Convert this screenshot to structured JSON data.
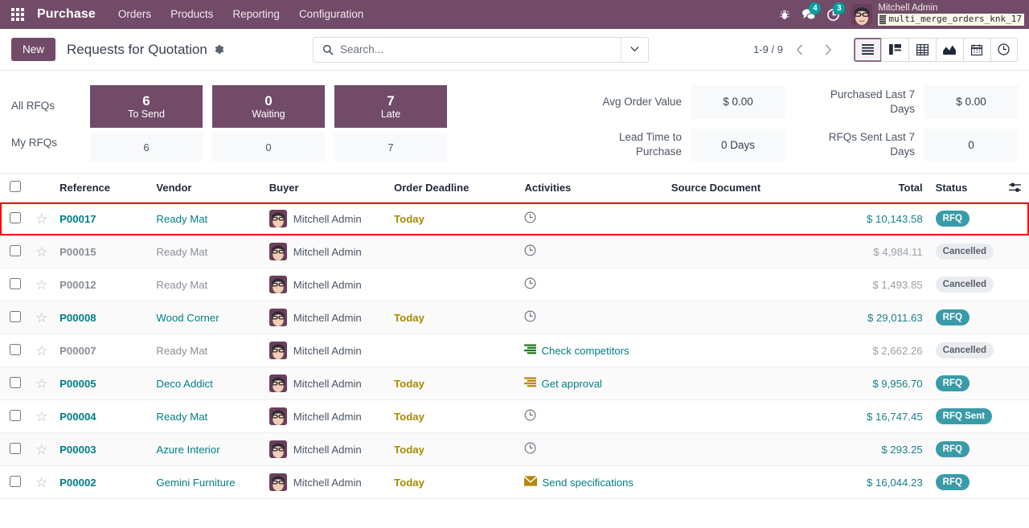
{
  "navbar": {
    "apps_icon": "grid-apps-icon",
    "brand": "Purchase",
    "menus": [
      "Orders",
      "Products",
      "Reporting",
      "Configuration"
    ],
    "icons": [
      {
        "name": "bug-icon",
        "glyph": "bug"
      },
      {
        "name": "messages-icon",
        "glyph": "chat",
        "count": "4"
      },
      {
        "name": "activities-icon",
        "glyph": "clock",
        "count": "3"
      }
    ],
    "user_name": "Mitchell Admin",
    "database": "multi_merge_orders_knk_17",
    "avatar": "user-avatar"
  },
  "control_panel": {
    "new_label": "New",
    "breadcrumb": "Requests for Quotation",
    "gear_icon": "gear-icon",
    "search": {
      "placeholder": "Search...",
      "value": "",
      "icon": "search-icon",
      "caret_icon": "chevron-down-icon"
    },
    "pager": "1-9 / 9",
    "prev_icon": "chevron-left-icon",
    "next_icon": "chevron-right-icon",
    "views": [
      {
        "name": "view-list",
        "icon": "list-icon",
        "active": true
      },
      {
        "name": "view-kanban",
        "icon": "kanban-icon",
        "active": false
      },
      {
        "name": "view-pivot",
        "icon": "pivot-icon",
        "active": false
      },
      {
        "name": "view-graph",
        "icon": "graph-icon",
        "active": false
      },
      {
        "name": "view-calendar",
        "icon": "calendar-icon",
        "active": false
      },
      {
        "name": "view-activity",
        "icon": "clock-icon",
        "active": false
      }
    ]
  },
  "dashboard": {
    "row_labels": [
      "All RFQs",
      "My RFQs"
    ],
    "counters": [
      {
        "label": "To Send",
        "all": "6",
        "mine": "6"
      },
      {
        "label": "Waiting",
        "all": "0",
        "mine": "0"
      },
      {
        "label": "Late",
        "all": "7",
        "mine": "7"
      }
    ],
    "metrics": [
      {
        "name": "Avg Order Value",
        "value": "$ 0.00"
      },
      {
        "name": "Lead Time to Purchase",
        "value": "0 Days"
      },
      {
        "name": "Purchased Last 7 Days",
        "value": "$ 0.00"
      },
      {
        "name": "RFQs Sent Last 7 Days",
        "value": "0"
      }
    ]
  },
  "table": {
    "headers": {
      "reference": "Reference",
      "vendor": "Vendor",
      "buyer": "Buyer",
      "deadline": "Order Deadline",
      "activities": "Activities",
      "source": "Source Document",
      "total": "Total",
      "status": "Status",
      "options_icon": "column-options-icon"
    },
    "rows": [
      {
        "reference": "P00017",
        "vendor": "Ready Mat",
        "buyer": "Mitchell Admin",
        "deadline": "Today",
        "activity_label": "",
        "activity_icon": "clock-icon",
        "source": "",
        "total": "$ 10,143.58",
        "status": "RFQ",
        "status_kind": "rfq",
        "muted": false,
        "selected": true
      },
      {
        "reference": "P00015",
        "vendor": "Ready Mat",
        "buyer": "Mitchell Admin",
        "deadline": "",
        "activity_label": "",
        "activity_icon": "clock-icon",
        "source": "",
        "total": "$ 4,984.11",
        "status": "Cancelled",
        "status_kind": "cancel",
        "muted": true,
        "selected": false
      },
      {
        "reference": "P00012",
        "vendor": "Ready Mat",
        "buyer": "Mitchell Admin",
        "deadline": "",
        "activity_label": "",
        "activity_icon": "clock-icon",
        "source": "",
        "total": "$ 1,493.85",
        "status": "Cancelled",
        "status_kind": "cancel",
        "muted": true,
        "selected": false
      },
      {
        "reference": "P00008",
        "vendor": "Wood Corner",
        "buyer": "Mitchell Admin",
        "deadline": "Today",
        "activity_label": "",
        "activity_icon": "clock-icon",
        "source": "",
        "total": "$ 29,011.63",
        "status": "RFQ",
        "status_kind": "rfq",
        "muted": false,
        "selected": false
      },
      {
        "reference": "P00007",
        "vendor": "Ready Mat",
        "buyer": "Mitchell Admin",
        "deadline": "",
        "activity_label": "Check competitors",
        "activity_icon": "todo-list-icon-green",
        "source": "",
        "total": "$ 2,662.26",
        "status": "Cancelled",
        "status_kind": "cancel",
        "muted": true,
        "selected": false
      },
      {
        "reference": "P00005",
        "vendor": "Deco Addict",
        "buyer": "Mitchell Admin",
        "deadline": "Today",
        "activity_label": "Get approval",
        "activity_icon": "todo-list-icon-amber",
        "source": "",
        "total": "$ 9,956.70",
        "status": "RFQ",
        "status_kind": "rfq",
        "muted": false,
        "selected": false
      },
      {
        "reference": "P00004",
        "vendor": "Ready Mat",
        "buyer": "Mitchell Admin",
        "deadline": "Today",
        "activity_label": "",
        "activity_icon": "clock-icon",
        "source": "",
        "total": "$ 16,747.45",
        "status": "RFQ Sent",
        "status_kind": "rfq",
        "muted": false,
        "selected": false
      },
      {
        "reference": "P00003",
        "vendor": "Azure Interior",
        "buyer": "Mitchell Admin",
        "deadline": "Today",
        "activity_label": "",
        "activity_icon": "clock-icon",
        "source": "",
        "total": "$ 293.25",
        "status": "RFQ",
        "status_kind": "rfq",
        "muted": false,
        "selected": false
      },
      {
        "reference": "P00002",
        "vendor": "Gemini Furniture",
        "buyer": "Mitchell Admin",
        "deadline": "Today",
        "activity_label": "Send specifications",
        "activity_icon": "envelope-icon-amber",
        "source": "",
        "total": "$ 16,044.23",
        "status": "RFQ",
        "status_kind": "rfq",
        "muted": false,
        "selected": false
      }
    ]
  },
  "colors": {
    "brand_purple": "#714B67",
    "badge_teal": "#3A9BA8",
    "link_teal": "#017E84",
    "deadline_amber": "#A68A00",
    "selection_red": "#ff0000",
    "activity_green": "#1a7a1a",
    "activity_amber": "#b5860b"
  }
}
